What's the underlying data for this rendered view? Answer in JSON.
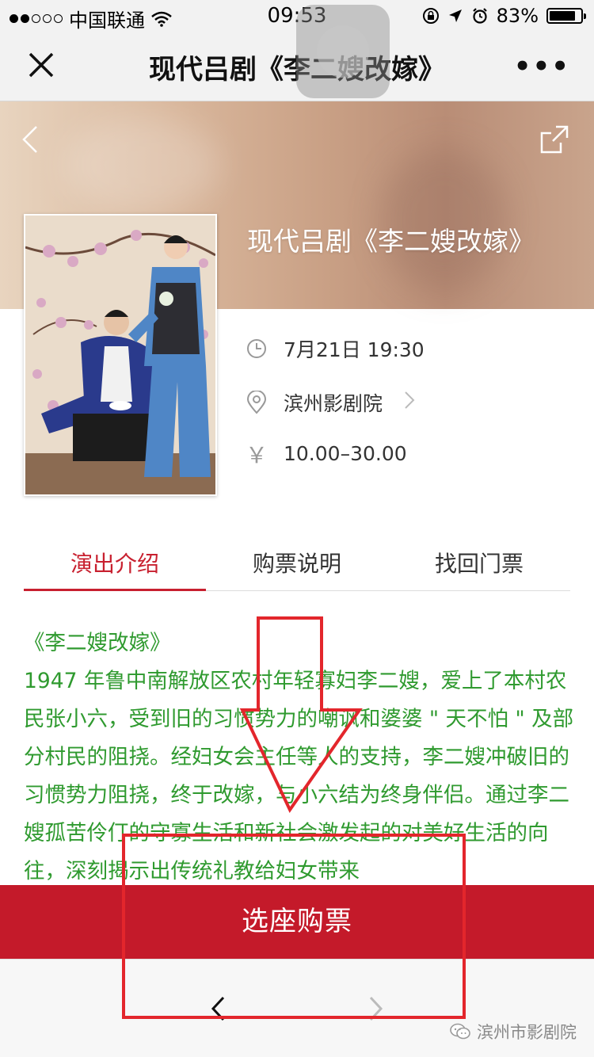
{
  "status_bar": {
    "carrier": "中国联通",
    "time": "09:53",
    "battery_pct_text": "83%",
    "battery_level": 0.83
  },
  "nav": {
    "title": "现代吕剧《李二嫂改嫁》",
    "more_label": "•••"
  },
  "show": {
    "title": "现代吕剧《李二嫂改嫁》",
    "datetime": "7月21日 19:30",
    "venue": "滨州影剧院",
    "price": "10.00–30.00",
    "price_symbol": "￥"
  },
  "tabs": [
    {
      "label": "演出介绍",
      "active": true
    },
    {
      "label": "购票说明",
      "active": false
    },
    {
      "label": "找回门票",
      "active": false
    }
  ],
  "intro": {
    "heading": "《李二嫂改嫁》",
    "body": "1947 年鲁中南解放区农村年轻寡妇李二嫂，爱上了本村农民张小六，受到旧的习惯势力的嘲讽和婆婆 \" 天不怕 \" 及部分村民的阻挠。经妇女会主任等人的支持，李二嫂冲破旧的习惯势力阻挠，终于改嫁，与小六结为终身伴侣。通过李二嫂孤苦伶仃的守寡生活和新社会激发起的对美好生活的向往，深刻揭示出传统礼教给妇女带来"
  },
  "buy_button": "选座购票",
  "watermark": "滨州市影剧院",
  "colors": {
    "accent": "#c8202f",
    "buy_bar": "#c41a2a",
    "intro_text": "#2f9a2f",
    "annotation": "#e3262c"
  }
}
